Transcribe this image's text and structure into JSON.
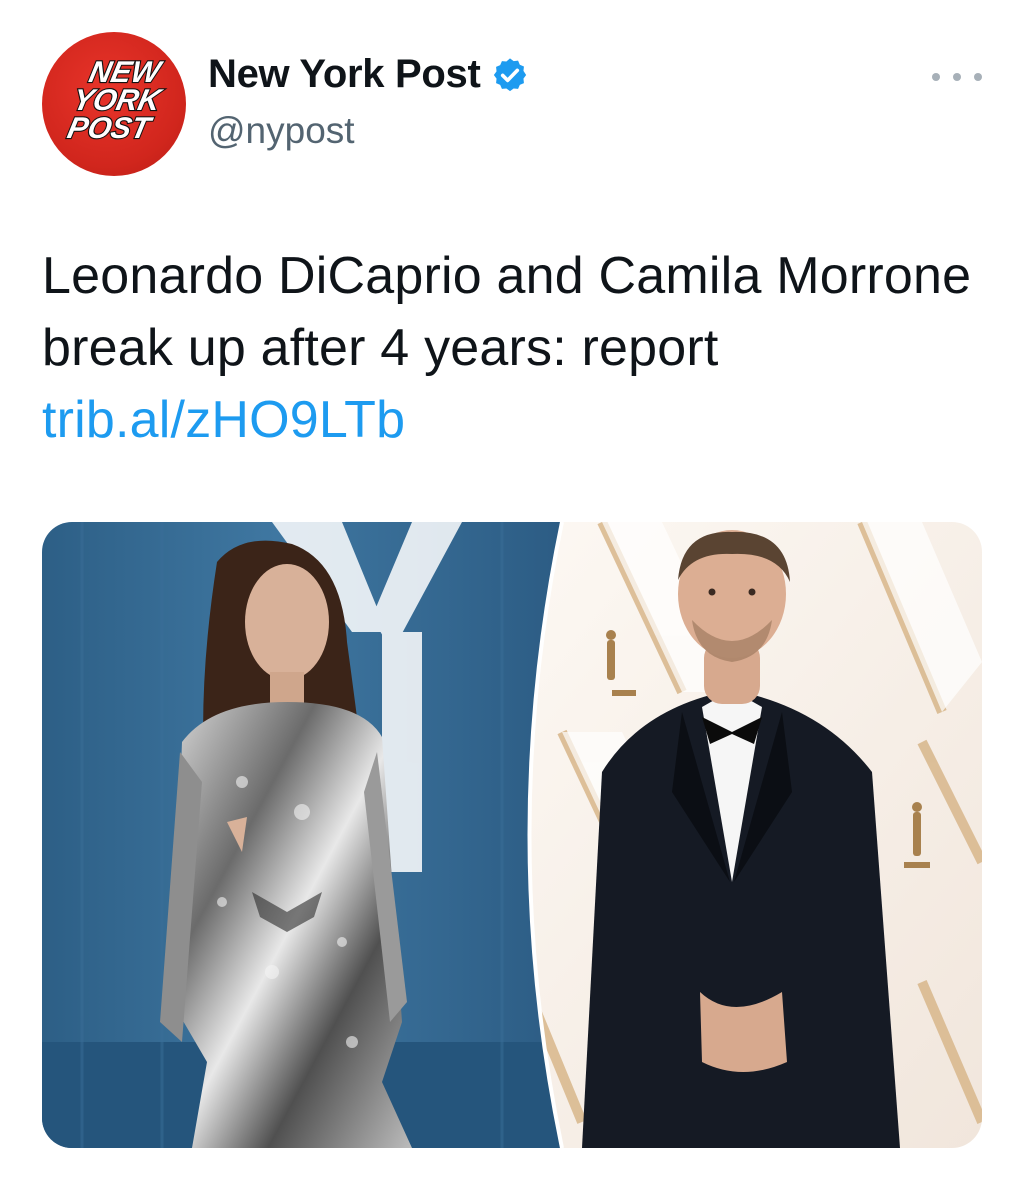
{
  "account": {
    "display_name": "New York Post",
    "handle": "@nypost",
    "verified": true,
    "avatar": {
      "logo_text": [
        "NEW",
        "YORK",
        "POST"
      ],
      "color": "#d1261d"
    }
  },
  "menu": {
    "more_icon": "more-horizontal-icon"
  },
  "tweet": {
    "text": "Leonardo DiCaprio and Camila Morrone break up after 4 years: report",
    "link_text": "trib.al/zHO9LTb"
  },
  "media": {
    "panels": [
      "woman in silver sequin dress at blue backdrop",
      "man in black tuxedo at awards backdrop"
    ]
  },
  "colors": {
    "link": "#1d9bf0",
    "verified": "#1d9bf0",
    "text": "#0f1419",
    "secondary": "#536471"
  }
}
